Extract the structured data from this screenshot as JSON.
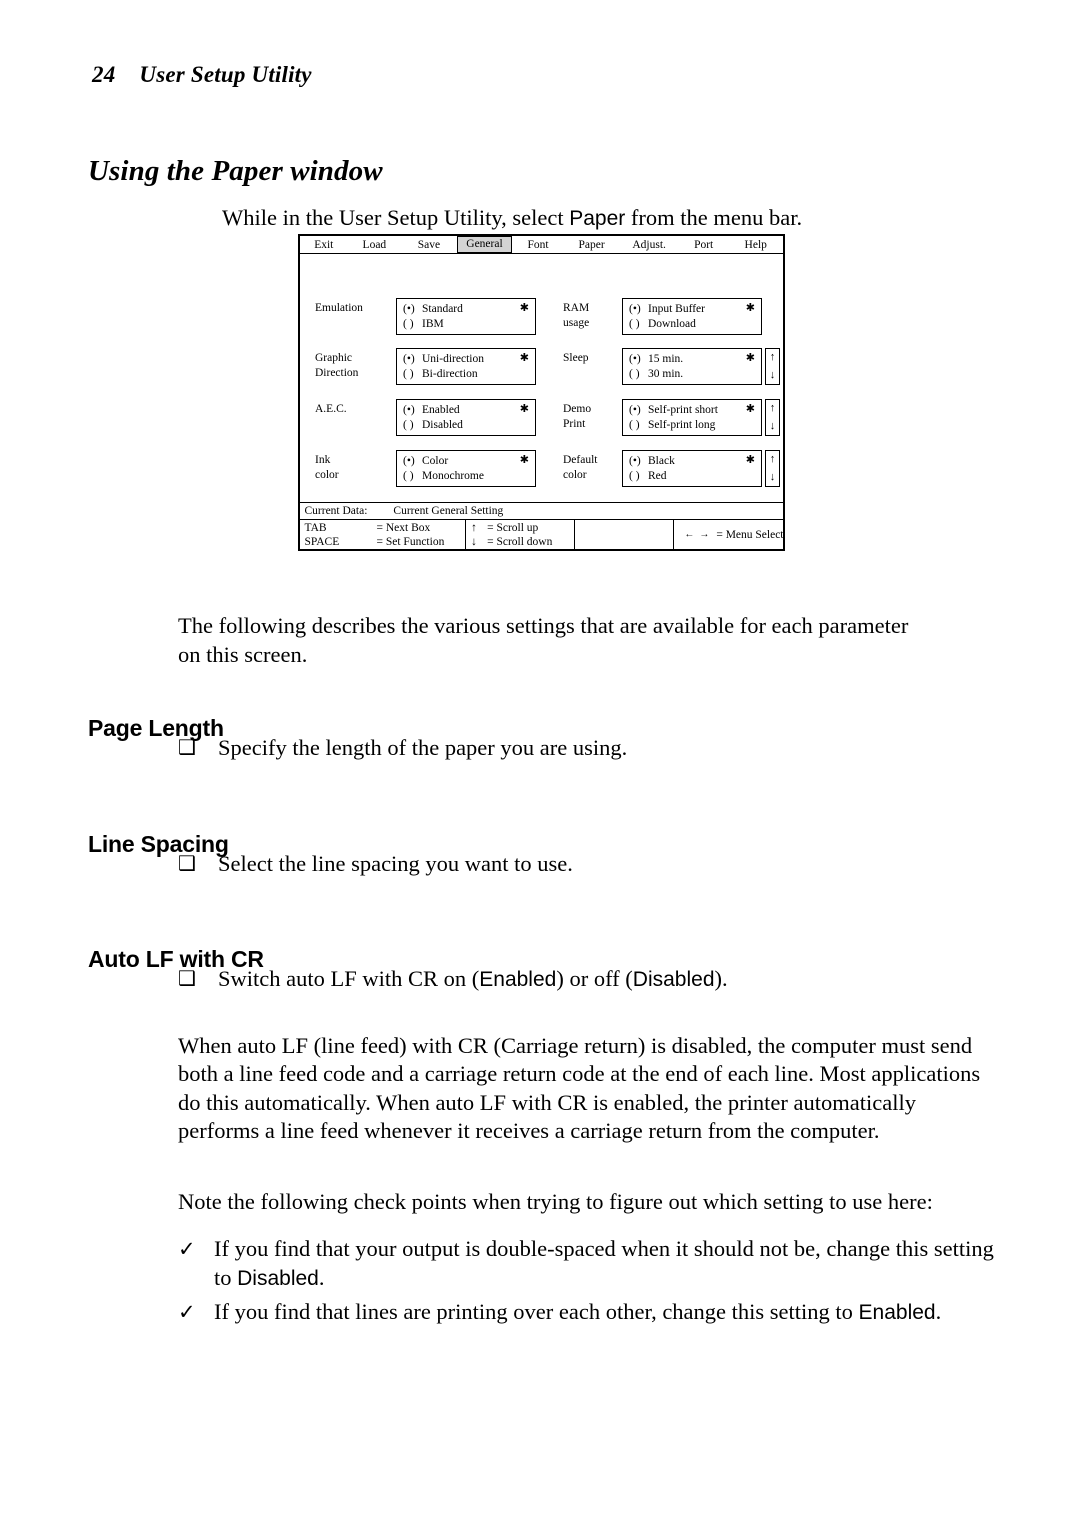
{
  "page": {
    "number": "24",
    "running_head": "User Setup Utility",
    "section_title": "Using the Paper window"
  },
  "intro": {
    "before": "While in the User Setup Utility, select ",
    "emphasis": "Paper",
    "after": " from the menu bar."
  },
  "figure": {
    "menubar": [
      {
        "label": "Exit",
        "selected": false
      },
      {
        "label": "Load",
        "selected": false
      },
      {
        "label": "Save",
        "selected": false
      },
      {
        "label": "General",
        "selected": true
      },
      {
        "label": "Font",
        "selected": false
      },
      {
        "label": "Paper",
        "selected": false
      },
      {
        "label": "Adjust.",
        "selected": false
      },
      {
        "label": "Port",
        "selected": false
      },
      {
        "label": "Help",
        "selected": false
      }
    ],
    "params_left": [
      {
        "label_line1": "Emulation",
        "label_line2": "",
        "options": [
          {
            "marker": "(•)",
            "text": "Standard",
            "star": "✱"
          },
          {
            "marker": "( )",
            "text": "IBM",
            "star": ""
          }
        ],
        "scroll": false
      },
      {
        "label_line1": "Graphic",
        "label_line2": "Direction",
        "options": [
          {
            "marker": "(•)",
            "text": "Uni-direction",
            "star": "✱"
          },
          {
            "marker": "( )",
            "text": "Bi-direction",
            "star": ""
          }
        ],
        "scroll": false
      },
      {
        "label_line1": "A.E.C.",
        "label_line2": "",
        "options": [
          {
            "marker": "(•)",
            "text": "Enabled",
            "star": "✱"
          },
          {
            "marker": "( )",
            "text": "Disabled",
            "star": ""
          }
        ],
        "scroll": false
      },
      {
        "label_line1": "Ink",
        "label_line2": "color",
        "options": [
          {
            "marker": "(•)",
            "text": "Color",
            "star": "✱"
          },
          {
            "marker": "( )",
            "text": "Monochrome",
            "star": ""
          }
        ],
        "scroll": false
      }
    ],
    "params_right": [
      {
        "label_line1": "RAM",
        "label_line2": "usage",
        "options": [
          {
            "marker": "(•)",
            "text": "Input Buffer",
            "star": "✱"
          },
          {
            "marker": "( )",
            "text": "Download",
            "star": ""
          }
        ],
        "scroll": false
      },
      {
        "label_line1": "Sleep",
        "label_line2": "",
        "options": [
          {
            "marker": "(•)",
            "text": "15 min.",
            "star": "✱"
          },
          {
            "marker": "( )",
            "text": "30 min.",
            "star": ""
          }
        ],
        "scroll": true
      },
      {
        "label_line1": "Demo",
        "label_line2": "Print",
        "options": [
          {
            "marker": "(•)",
            "text": "Self-print short",
            "star": "✱"
          },
          {
            "marker": "( )",
            "text": "Self-print long",
            "star": ""
          }
        ],
        "scroll": true
      },
      {
        "label_line1": "Default",
        "label_line2": "color",
        "options": [
          {
            "marker": "(•)",
            "text": "Black",
            "star": "✱"
          },
          {
            "marker": "( )",
            "text": "Red",
            "star": ""
          }
        ],
        "scroll": true
      }
    ],
    "status": {
      "current_data_label": "Current Data:",
      "current_data_value": "Current General Setting",
      "keys": {
        "tab_name": "TAB",
        "tab_action": "= Next Box",
        "space_name": "SPACE",
        "space_action": "= Set Function",
        "scroll_up_arrow": "↑",
        "scroll_up_action": "= Scroll up",
        "scroll_down_arrow": "↓",
        "scroll_down_action": "= Scroll down",
        "empty_cell": "",
        "menu_select_arrows": "←→",
        "menu_select_action": "= Menu Select"
      }
    }
  },
  "para_following": "The following describes the various settings that are available for each parameter on this screen.",
  "sections": [
    {
      "heading": "Page Length",
      "bullet_glyph": "❑",
      "bullet_text": "Specify the length of the paper you are using."
    },
    {
      "heading": "Line Spacing",
      "bullet_glyph": "❑",
      "bullet_text": "Select the line spacing you want to use."
    },
    {
      "heading": "Auto LF with CR",
      "bullet_glyph": "❑",
      "bullet_before": "Switch auto LF with CR on (",
      "bullet_emph1": "Enabled",
      "bullet_middle": ") or off (",
      "bullet_emph2": "Disabled",
      "bullet_after": ")."
    }
  ],
  "para_autolf": "When auto LF (line feed) with CR (Carriage return) is disabled, the computer must send both a line feed code and a carriage return code at the end of each line. Most applications do this automatically. When auto LF with CR is enabled, the printer automatically performs a line feed whenever it receives a carriage return from the computer.",
  "para_note": "Note the following check points when trying to figure out which setting to use here:",
  "checks": [
    {
      "glyph": "✓",
      "before": "If you find that your output is double-spaced when it should not be, change this setting to ",
      "emphasis": "Disabled",
      "after": "."
    },
    {
      "glyph": "✓",
      "before": "If you find that lines are printing over each other, change this setting to ",
      "emphasis": "Enabled",
      "after": "."
    }
  ]
}
